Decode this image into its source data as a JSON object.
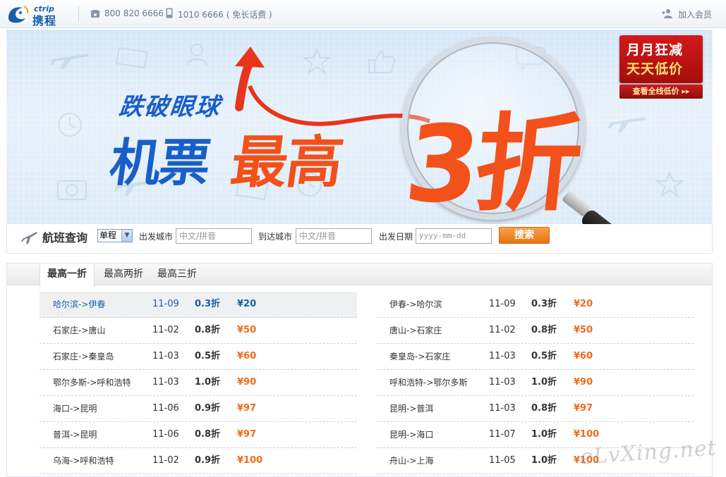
{
  "header": {
    "logo_en": "ctrip",
    "logo_cn": "携程",
    "phone1": "800 820 6666",
    "phone2": "1010 6666",
    "phone2_note": "( 免长话费 )",
    "join_label": "加入会员"
  },
  "banner": {
    "slogan_line1": "跌破眼球",
    "slogan_line2a": "机票",
    "slogan_line2b": "最高",
    "slogan_big": "3折",
    "promo_line1": "月月狂减",
    "promo_line2": "天天低价",
    "promo_button": "查看全线低价 ▸▸"
  },
  "search": {
    "title": "航班查询",
    "trip_type": "单程",
    "from_label": "出发城市",
    "from_placeholder": "中文/拼音",
    "to_label": "到达城市",
    "to_placeholder": "中文/拼音",
    "date_label": "出发日期",
    "date_placeholder": "yyyy-mm-dd",
    "button": "搜索"
  },
  "tabs": [
    "最高一折",
    "最高两折",
    "最高三折"
  ],
  "deals_left": [
    {
      "route": "哈尔滨->伊春",
      "date": "11-09",
      "discount": "0.3折",
      "price": "¥20"
    },
    {
      "route": "石家庄->唐山",
      "date": "11-02",
      "discount": "0.8折",
      "price": "¥50"
    },
    {
      "route": "石家庄->秦皇岛",
      "date": "11-03",
      "discount": "0.5折",
      "price": "¥60"
    },
    {
      "route": "鄂尔多斯->呼和浩特",
      "date": "11-03",
      "discount": "1.0折",
      "price": "¥90"
    },
    {
      "route": "海口->昆明",
      "date": "11-06",
      "discount": "0.9折",
      "price": "¥97"
    },
    {
      "route": "普洱->昆明",
      "date": "11-06",
      "discount": "0.8折",
      "price": "¥97"
    },
    {
      "route": "乌海->呼和浩特",
      "date": "11-02",
      "discount": "0.9折",
      "price": "¥100"
    }
  ],
  "deals_right": [
    {
      "route": "伊春->哈尔滨",
      "date": "11-09",
      "discount": "0.3折",
      "price": "¥20"
    },
    {
      "route": "唐山->石家庄",
      "date": "11-02",
      "discount": "0.8折",
      "price": "¥50"
    },
    {
      "route": "秦皇岛->石家庄",
      "date": "11-03",
      "discount": "0.5折",
      "price": "¥60"
    },
    {
      "route": "呼和浩特->鄂尔多斯",
      "date": "11-03",
      "discount": "1.0折",
      "price": "¥90"
    },
    {
      "route": "昆明->普洱",
      "date": "11-03",
      "discount": "0.8折",
      "price": "¥97"
    },
    {
      "route": "昆明->海口",
      "date": "11-07",
      "discount": "1.0折",
      "price": "¥100"
    },
    {
      "route": "舟山->上海",
      "date": "11-05",
      "discount": "1.0折",
      "price": "¥100"
    }
  ],
  "watermark": "eLvXing.net",
  "colors": {
    "brand_blue": "#1b5ea8",
    "price_orange": "#f26a1b",
    "banner_red": "#f2511b"
  }
}
